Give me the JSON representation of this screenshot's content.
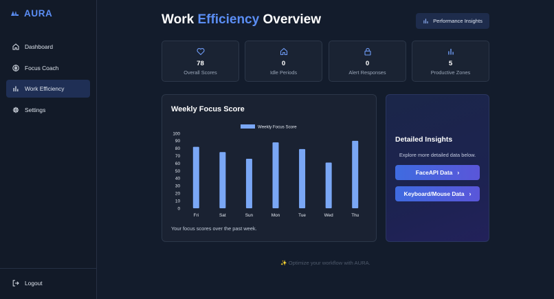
{
  "app": {
    "name": "AURA"
  },
  "sidebar": {
    "items": [
      {
        "label": "Dashboard",
        "icon": "home-icon",
        "active": false
      },
      {
        "label": "Focus Coach",
        "icon": "compass-icon",
        "active": false
      },
      {
        "label": "Work Efficiency",
        "icon": "bar-chart-icon",
        "active": true
      },
      {
        "label": "Settings",
        "icon": "gear-icon",
        "active": false
      }
    ],
    "logout_label": "Logout"
  },
  "header": {
    "title_part1": "Work ",
    "title_accent": "Efficiency",
    "title_part2": " Overview",
    "insights_button": "Performance Insights"
  },
  "stats": [
    {
      "icon": "heart-icon",
      "value": "78",
      "label": "Overall Scores"
    },
    {
      "icon": "home-icon",
      "value": "0",
      "label": "Idle Periods"
    },
    {
      "icon": "lock-icon",
      "value": "0",
      "label": "Alert Responses"
    },
    {
      "icon": "bar-chart-icon",
      "value": "5",
      "label": "Productive Zones"
    }
  ],
  "chart_card": {
    "title": "Weekly Focus Score",
    "caption": "Your focus scores over the past week."
  },
  "chart_data": {
    "type": "bar",
    "categories": [
      "Fri",
      "Sat",
      "Sun",
      "Mon",
      "Tue",
      "Wed",
      "Thu"
    ],
    "series": [
      {
        "name": "Weekly Focus Score",
        "values": [
          82,
          75,
          66,
          88,
          79,
          61,
          90
        ],
        "color": "#7aa7f5"
      }
    ],
    "ylim": [
      0,
      100
    ],
    "yticks": [
      0,
      10,
      20,
      30,
      40,
      50,
      60,
      70,
      80,
      90,
      100
    ],
    "legend": "top-center",
    "grid": false
  },
  "detail_card": {
    "title": "Detailed Insights",
    "subtitle": "Explore more detailed data below.",
    "buttons": [
      "FaceAPI Data",
      "Keyboard/Mouse Data"
    ],
    "chevron": "›"
  },
  "footer": {
    "note": "✨ Optimize your workflow with AURA."
  },
  "colors": {
    "accent": "#5b8ef5",
    "bar": "#7aa7f5",
    "background": "#131c2c"
  }
}
